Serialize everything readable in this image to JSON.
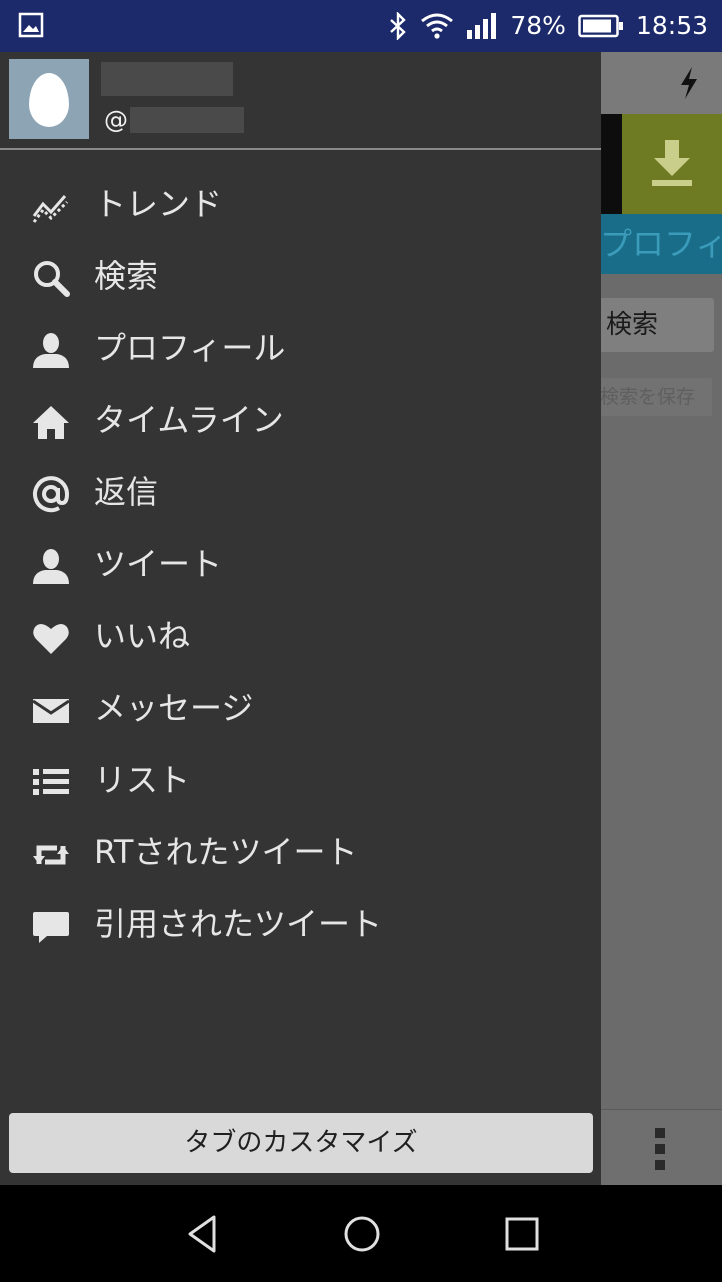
{
  "status_bar": {
    "battery_percent": "78%",
    "time": "18:53",
    "icons": [
      "image-icon",
      "bluetooth-icon",
      "wifi-icon",
      "signal-icon",
      "battery-icon"
    ]
  },
  "drawer": {
    "handle_prefix": "@",
    "menu": [
      {
        "label": "トレンド",
        "icon": "trend-icon"
      },
      {
        "label": "検索",
        "icon": "search-icon"
      },
      {
        "label": "プロフィール",
        "icon": "person-icon"
      },
      {
        "label": "タイムライン",
        "icon": "home-icon"
      },
      {
        "label": "返信",
        "icon": "at-icon"
      },
      {
        "label": "ツイート",
        "icon": "person-icon"
      },
      {
        "label": "いいね",
        "icon": "heart-icon"
      },
      {
        "label": "メッセージ",
        "icon": "envelope-icon"
      },
      {
        "label": "リスト",
        "icon": "list-icon"
      },
      {
        "label": "RTされたツイート",
        "icon": "retweet-icon"
      },
      {
        "label": "引用されたツイート",
        "icon": "speech-bubble-icon"
      }
    ],
    "customize_label": "タブのカスタマイズ"
  },
  "background_app": {
    "tab_fragment": "プロフィ",
    "search_button": "検索",
    "save_search_button": "検索を保存"
  },
  "colors": {
    "status_bar": "#1c2a6b",
    "drawer": "#343434",
    "accent_banner": "#6f7b22",
    "tab_strip": "#1a6d88"
  }
}
